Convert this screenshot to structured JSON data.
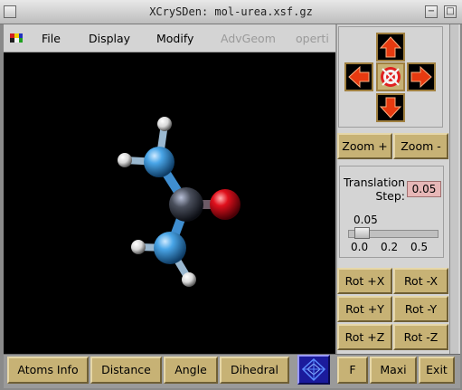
{
  "window": {
    "title": "XCrySDen: mol-urea.xsf.gz",
    "minimize_glyph": "−",
    "maximize_glyph": "□",
    "close_glyph": "×"
  },
  "menu": {
    "file": "File",
    "display": "Display",
    "modify": "Modify",
    "advgeom": "AdvGeom",
    "properties": "operti"
  },
  "nav": {
    "up_icon": "arrow-up-icon",
    "left_icon": "arrow-left-icon",
    "right_icon": "arrow-right-icon",
    "down_icon": "arrow-down-icon",
    "center_icon": "target-icon"
  },
  "zoom": {
    "in_label": "Zoom +",
    "out_label": "Zoom -"
  },
  "translation": {
    "label_line1": "Translation",
    "label_line2": "Step:",
    "value": "0.05",
    "slider_value": "0.05",
    "ticks": [
      "0.0",
      "0.2",
      "0.5"
    ]
  },
  "rotation": {
    "plus_x": "Rot +X",
    "minus_x": "Rot -X",
    "plus_y": "Rot +Y",
    "minus_y": "Rot -Y",
    "plus_z": "Rot +Z",
    "minus_z": "Rot -Z"
  },
  "bottom": {
    "atoms_info": "Atoms Info",
    "distance": "Distance",
    "angle": "Angle",
    "dihedral": "Dihedral",
    "f": "F",
    "maxi": "Maxi",
    "exit": "Exit"
  },
  "colors": {
    "viewport_bg": "#000000",
    "button_tan": "#c7b275",
    "nitrogen": "#4aa6e8",
    "carbon": "#4a4f5c",
    "oxygen": "#e0101c",
    "hydrogen": "#ffffff",
    "translation_input_bg": "#e7b7b7",
    "arrow_red": "#e63a10",
    "arrow_border": "#a08040"
  }
}
